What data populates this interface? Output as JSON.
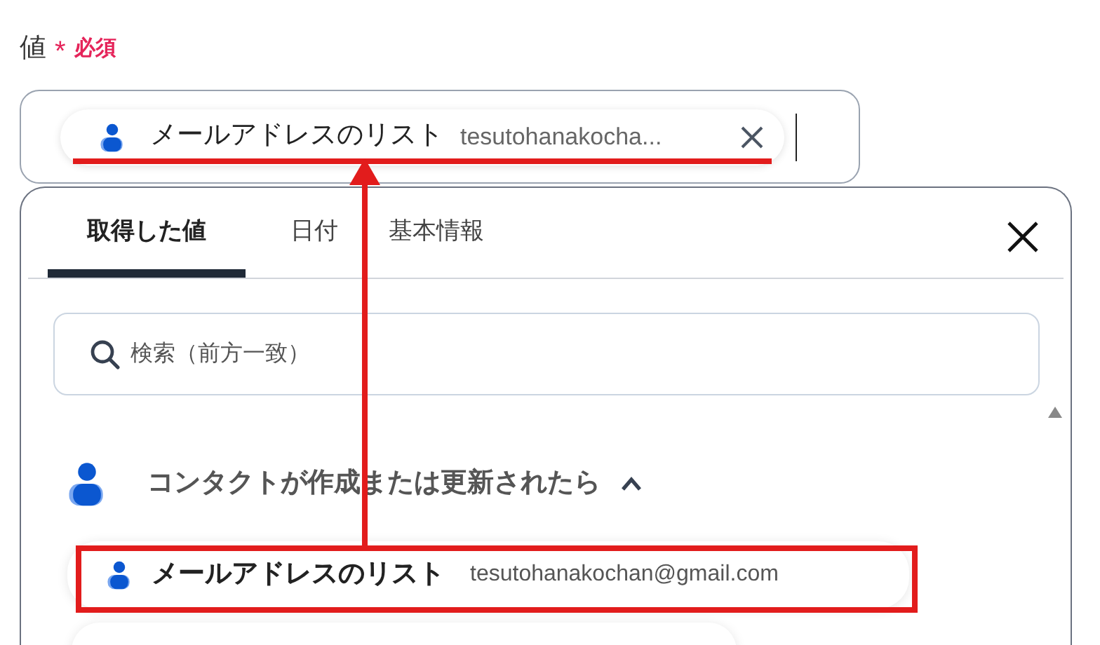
{
  "field": {
    "label": "値",
    "required_mark": "*",
    "required_text": "必須",
    "chip": {
      "name": "メールアドレスのリスト",
      "value": "tesutohanakocha..."
    }
  },
  "tabs": [
    {
      "label": "取得した値",
      "selected": true
    },
    {
      "label": "日付",
      "selected": false
    },
    {
      "label": "基本情報",
      "selected": false
    }
  ],
  "search": {
    "placeholder": "検索（前方一致）"
  },
  "group": {
    "title": "コンタクトが作成または更新されたら",
    "expanded": true,
    "items": [
      {
        "name": "メールアドレスのリスト",
        "value": "tesutohanakochan@gmail.com"
      }
    ]
  }
}
